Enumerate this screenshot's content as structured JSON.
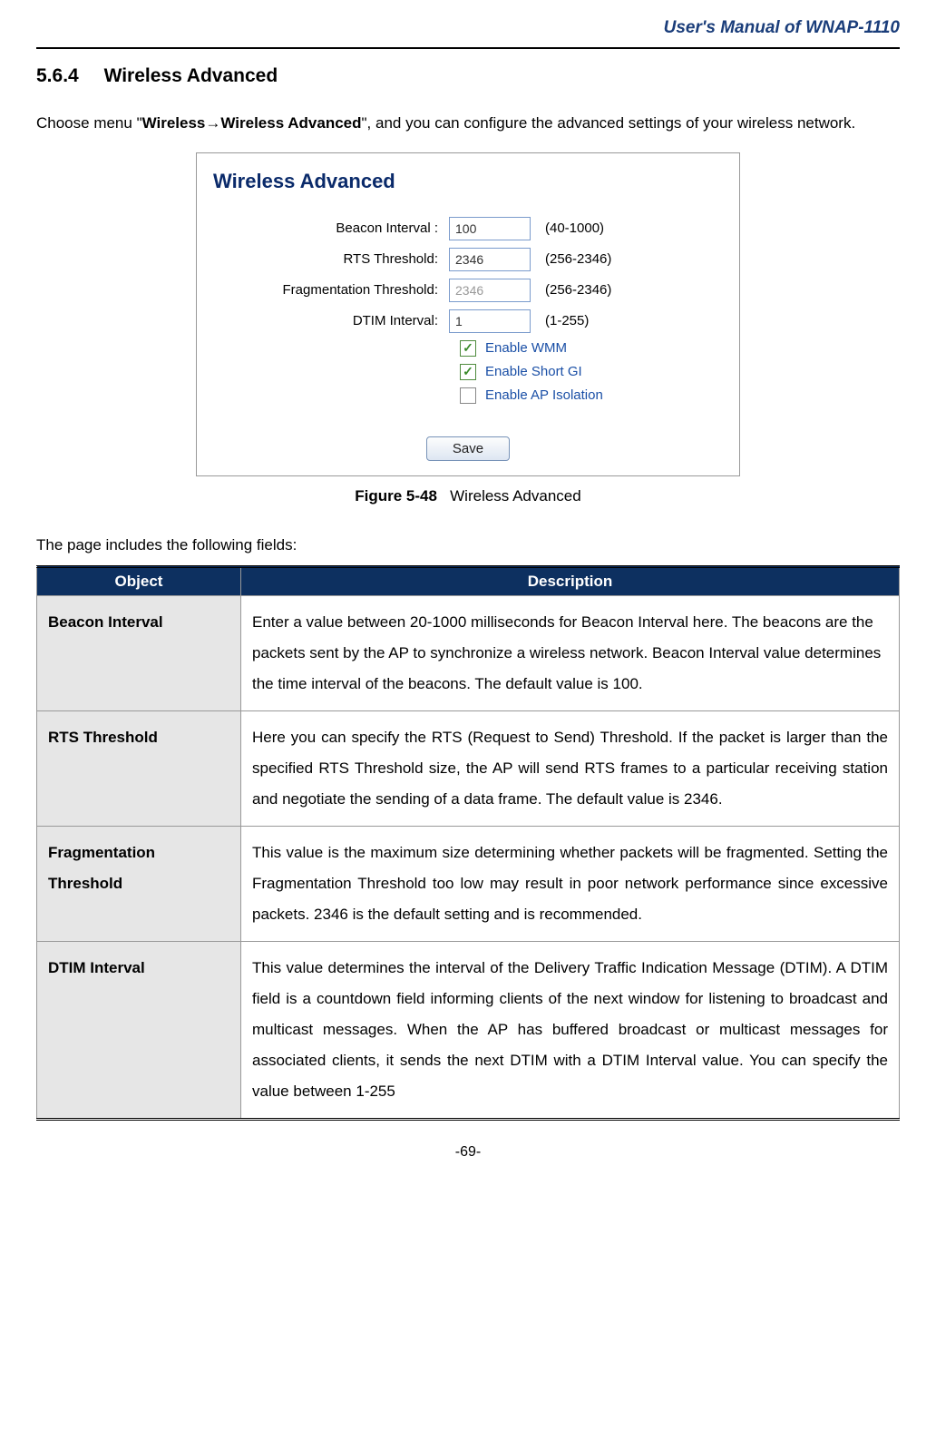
{
  "header": {
    "title": "User's Manual of WNAP-1110"
  },
  "section": {
    "number": "5.6.4",
    "title": "Wireless Advanced"
  },
  "intro": {
    "pre": "Choose menu \"",
    "menu_boldA": "Wireless",
    "arrow": "→",
    "menu_boldB": "Wireless Advanced",
    "post": "\", and you can configure the advanced settings of your wireless network."
  },
  "screenshot": {
    "panel_title": "Wireless Advanced",
    "rows": {
      "beacon": {
        "label": "Beacon Interval :",
        "value": "100",
        "range": "(40-1000)"
      },
      "rts": {
        "label": "RTS Threshold:",
        "value": "2346",
        "range": "(256-2346)"
      },
      "frag": {
        "label": "Fragmentation Threshold:",
        "value": "2346",
        "range": "(256-2346)"
      },
      "dtim": {
        "label": "DTIM Interval:",
        "value": "1",
        "range": "(1-255)"
      }
    },
    "checkboxes": {
      "wmm": {
        "label": "Enable WMM",
        "checked": true
      },
      "gi": {
        "label": "Enable Short GI",
        "checked": true
      },
      "apiso": {
        "label": "Enable AP Isolation",
        "checked": false
      }
    },
    "save_label": "Save"
  },
  "figure": {
    "num": "Figure 5-48",
    "title": "Wireless Advanced"
  },
  "fields_intro": "The page includes the following fields:",
  "table": {
    "headers": {
      "object": "Object",
      "description": "Description"
    },
    "rows": [
      {
        "object": "Beacon Interval",
        "desc": "Enter a value between 20-1000 milliseconds for Beacon Interval here. The beacons are the packets sent by the AP to synchronize a wireless network. Beacon Interval value determines the time interval of the beacons. The default value is 100.",
        "justify": false
      },
      {
        "object": "RTS Threshold",
        "desc": "Here you can specify the RTS (Request to Send) Threshold. If the packet is larger than the specified RTS Threshold size, the AP will send RTS frames to a particular receiving station and negotiate the sending of a data frame. The default value is 2346.",
        "justify": true
      },
      {
        "object": "Fragmentation Threshold",
        "desc": "This value is the maximum size determining whether packets will be fragmented. Setting the Fragmentation Threshold too low may result in poor network performance since excessive packets. 2346 is the default setting and is recommended.",
        "justify": true
      },
      {
        "object": "DTIM Interval",
        "desc": "This value determines the interval of the Delivery Traffic Indication Message (DTIM). A DTIM field is a countdown field informing clients of the next window for listening to broadcast and multicast messages. When the AP has buffered broadcast or multicast messages for associated clients, it sends the next DTIM with a DTIM Interval value. You can specify the value between 1-255",
        "justify": true
      }
    ]
  },
  "page_number": "-69-"
}
